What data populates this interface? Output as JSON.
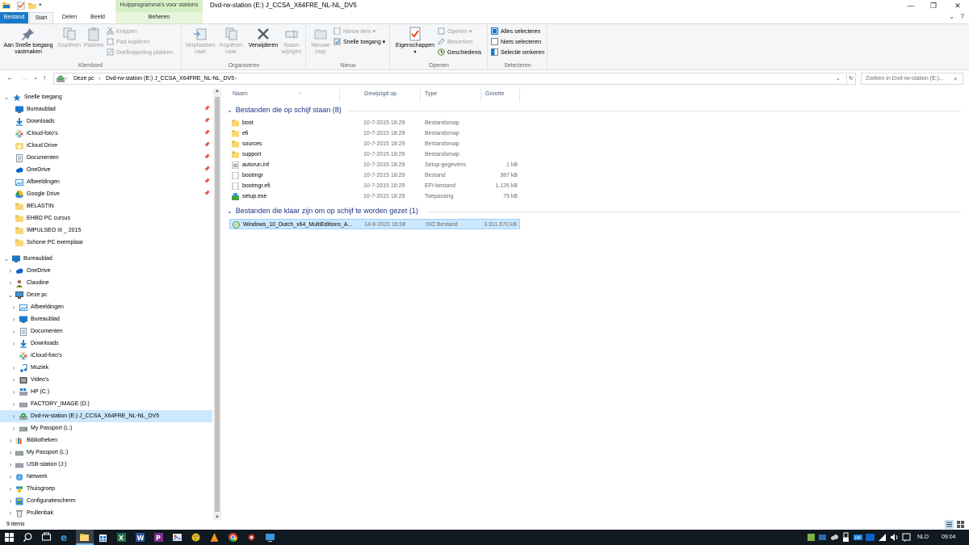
{
  "window": {
    "title": "Dvd-rw-station (E:) J_CCSA_X64FRE_NL-NL_DV5",
    "context_tab_group": "Hulpprogramma's voor stations",
    "minimize": "—",
    "maximize": "❐",
    "close": "✕"
  },
  "ribbon_tabs": {
    "file": "Bestand",
    "start": "Start",
    "share": "Delen",
    "view": "Beeld",
    "manage": "Beheren",
    "expand": "⌄",
    "help": "?"
  },
  "ribbon": {
    "klembord": {
      "label": "Klembord",
      "pin": "Aan Snelle toegang vastmaken",
      "copy": "Kopiëren",
      "paste": "Plakken",
      "cut": "Knippen",
      "copy_path": "Pad kopiëren",
      "paste_shortcut": "Snelkoppeling plakken"
    },
    "organiseren": {
      "label": "Organiseren",
      "move_to": "Verplaatsen naar",
      "copy_to": "Kopiëren naar",
      "delete": "Verwijderen",
      "rename": "Naam wijzigen"
    },
    "nieuw": {
      "label": "Nieuw",
      "new_folder": "Nieuwe map",
      "new_item": "Nieuw item",
      "easy_access": "Snelle toegang"
    },
    "openen": {
      "label": "Openen",
      "properties": "Eigenschappen",
      "open": "Openen",
      "edit": "Bewerken",
      "history": "Geschiedenis"
    },
    "selecteren": {
      "label": "Selecteren",
      "select_all": "Alles selecteren",
      "select_none": "Niets selecteren",
      "invert": "Selectie omkeren"
    }
  },
  "address": {
    "back": "←",
    "forward": "→",
    "recent": "⌄",
    "up": "↑",
    "crumbs": [
      "Deze pc",
      "Dvd-rw-station (E:) J_CCSA_X64FRE_NL-NL_DV5"
    ],
    "separator": "›",
    "dropdown": "⌄",
    "refresh": "↻",
    "search_placeholder": "Zoeken in Dvd-rw-station (E:)..."
  },
  "nav": {
    "quick_access": {
      "label": "Snelle toegang",
      "items": [
        {
          "label": "Bureaublad",
          "pinned": true
        },
        {
          "label": "Downloads",
          "pinned": true
        },
        {
          "label": "iCloud-foto's",
          "pinned": true
        },
        {
          "label": "iCloud Drive",
          "pinned": true
        },
        {
          "label": "Documenten",
          "pinned": true
        },
        {
          "label": "OneDrive",
          "pinned": true
        },
        {
          "label": "Afbeeldingen",
          "pinned": true
        },
        {
          "label": "Google Drive",
          "pinned": true
        },
        {
          "label": "BELASTIN",
          "pinned": false
        },
        {
          "label": "EHBO PC cursus",
          "pinned": false
        },
        {
          "label": "IMPULSEO III _ 2015",
          "pinned": false
        },
        {
          "label": "Schone PC exemplaar",
          "pinned": false
        }
      ]
    },
    "desktop": {
      "label": "Bureaublad",
      "items": [
        "OneDrive",
        "Claudine"
      ]
    },
    "this_pc": {
      "label": "Deze pc",
      "items": [
        "Afbeeldingen",
        "Bureaublad",
        "Documenten",
        "Downloads",
        "iCloud-foto's",
        "Muziek",
        "Video's",
        "HP (C:)",
        "FACTORY_IMAGE (D:)",
        "Dvd-rw-station (E:) J_CCSA_X64FRE_NL-NL_DV5",
        "My Passport (L:)"
      ]
    },
    "bottom_items": [
      "Bibliotheken",
      "My Passport (L:)",
      "USB-station (J:)",
      "Netwerk",
      "Thuisgroep",
      "Configuratiescherm",
      "Prullenbak"
    ],
    "pin_glyph": "📌"
  },
  "columns": {
    "name": "Naam",
    "modified": "Gewijzigd op",
    "type": "Type",
    "size": "Grootte",
    "sort_glyph": "^"
  },
  "groups": [
    {
      "title": "Bestanden die op schijf staan (8)",
      "files": [
        {
          "name": "boot",
          "date": "10-7-2015 18:29",
          "type": "Bestandsmap",
          "size": "",
          "icon": "folder-icon"
        },
        {
          "name": "efi",
          "date": "10-7-2015 18:29",
          "type": "Bestandsmap",
          "size": "",
          "icon": "folder-icon"
        },
        {
          "name": "sources",
          "date": "10-7-2015 18:29",
          "type": "Bestandsmap",
          "size": "",
          "icon": "folder-icon"
        },
        {
          "name": "support",
          "date": "10-7-2015 18:29",
          "type": "Bestandsmap",
          "size": "",
          "icon": "folder-icon"
        },
        {
          "name": "autorun.inf",
          "date": "10-7-2015 18:29",
          "type": "Setup-gegevens",
          "size": "1 kB",
          "icon": "settings-file-icon"
        },
        {
          "name": "bootmgr",
          "date": "10-7-2015 18:29",
          "type": "Bestand",
          "size": "387 kB",
          "icon": "file-icon"
        },
        {
          "name": "bootmgr.efi",
          "date": "10-7-2015 18:29",
          "type": "EFI-bestand",
          "size": "1.126 kB",
          "icon": "file-icon"
        },
        {
          "name": "setup.exe",
          "date": "10-7-2015 18:29",
          "type": "Toepassing",
          "size": "79 kB",
          "icon": "setup-icon"
        }
      ]
    },
    {
      "title": "Bestanden die klaar zijn om op schijf te worden gezet (1)",
      "files": [
        {
          "name": "Windows_10_Dutch_x64_MultiEditions_A...",
          "date": "14-8-2015 16:08",
          "type": "ISO Bestand",
          "size": "3.911.670 kB",
          "icon": "disc-image-icon"
        }
      ]
    }
  ],
  "status": {
    "count": "9 items"
  },
  "taskbar": {
    "language": "NLD",
    "time": "09:04"
  },
  "colors": {
    "accent": "#1979ca",
    "selection": "#cce8ff",
    "group_header": "#1e3287",
    "folder": "#f8d775",
    "taskbar": "#101820"
  }
}
